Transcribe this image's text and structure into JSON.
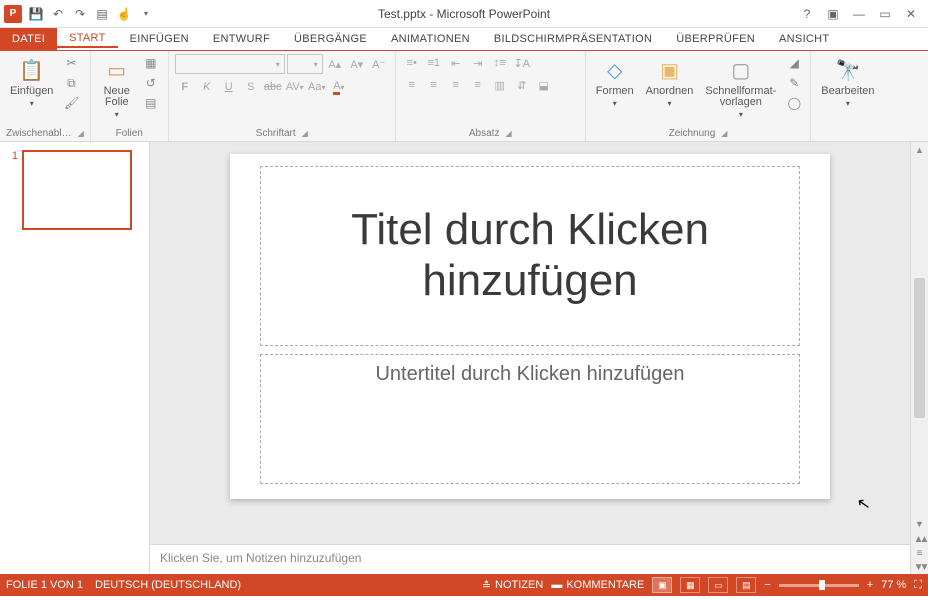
{
  "window": {
    "title": "Test.pptx - Microsoft PowerPoint"
  },
  "qat": {
    "save": {
      "glyph": "💾"
    },
    "undo": {
      "glyph": "↶"
    },
    "redo": {
      "glyph": "↷"
    },
    "present": {
      "glyph": "▤"
    },
    "touch": {
      "glyph": "☝"
    }
  },
  "win": {
    "help": "?",
    "ribbon_opts": "▣",
    "min": "—",
    "max": "▭",
    "close": "✕"
  },
  "tabs": {
    "file": "DATEI",
    "items": [
      "START",
      "EINFÜGEN",
      "ENTWURF",
      "ÜBERGÄNGE",
      "ANIMATIONEN",
      "BILDSCHIRMPRÄSENTATION",
      "ÜBERPRÜFEN",
      "ANSICHT"
    ],
    "active_index": 0
  },
  "ribbon": {
    "clipboard": {
      "label": "Zwischenabl…",
      "paste": "Einfügen"
    },
    "slides": {
      "label": "Folien",
      "new_slide": "Neue\nFolie"
    },
    "font": {
      "label": "Schriftart",
      "bold": "F",
      "italic": "K",
      "underline": "U",
      "shadow": "S",
      "strike": "abc",
      "spacing": "AV",
      "case": "Aa",
      "color": "A"
    },
    "paragraph": {
      "label": "Absatz"
    },
    "drawing": {
      "label": "Zeichnung",
      "shapes": "Formen",
      "arrange": "Anordnen",
      "quickstyles": "Schnellformat-\nvorlagen"
    },
    "editing": {
      "label": "",
      "edit": "Bearbeiten"
    }
  },
  "thumbnails": {
    "items": [
      {
        "num": "1"
      }
    ]
  },
  "slide": {
    "title_placeholder": "Titel durch Klicken hinzufügen",
    "subtitle_placeholder": "Untertitel durch Klicken hinzufügen"
  },
  "notes": {
    "placeholder": "Klicken Sie, um Notizen hinzuzufügen"
  },
  "status": {
    "slide_counter": "FOLIE 1 VON 1",
    "language": "DEUTSCH (DEUTSCHLAND)",
    "notes_btn": "NOTIZEN",
    "comments_btn": "KOMMENTARE",
    "zoom": "77 %"
  }
}
